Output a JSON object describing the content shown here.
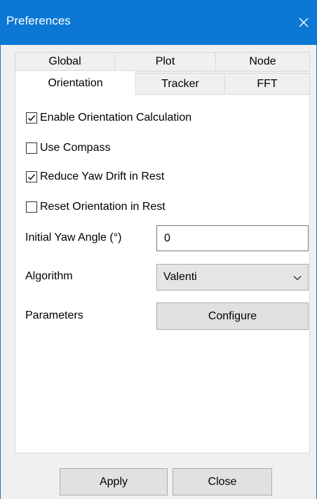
{
  "window": {
    "title": "Preferences"
  },
  "icons": {
    "close": "close-icon",
    "checkmark": "checkmark-icon",
    "dropdown": "chevron-down-icon"
  },
  "tabs": {
    "row1": [
      {
        "label": "Global"
      },
      {
        "label": "Plot"
      },
      {
        "label": "Node"
      }
    ],
    "row2": [
      {
        "label": "Orientation",
        "active": true
      },
      {
        "label": "Tracker"
      },
      {
        "label": "FFT"
      }
    ]
  },
  "options": [
    {
      "label": "Enable Orientation Calculation",
      "checked": true
    },
    {
      "label": "Use Compass",
      "checked": false
    },
    {
      "label": "Reduce Yaw Drift in Rest",
      "checked": true
    },
    {
      "label": "Reset Orientation in Rest",
      "checked": false
    }
  ],
  "fields": {
    "initial_yaw": {
      "label": "Initial Yaw Angle (°)",
      "value": "0"
    },
    "algorithm": {
      "label": "Algorithm",
      "selected": "Valenti"
    },
    "parameters": {
      "label": "Parameters",
      "button": "Configure"
    }
  },
  "footer": {
    "apply": "Apply",
    "close": "Close"
  },
  "colors": {
    "titlebar": "#0a78d4",
    "background": "#f0f0f0",
    "panel": "#ffffff"
  }
}
